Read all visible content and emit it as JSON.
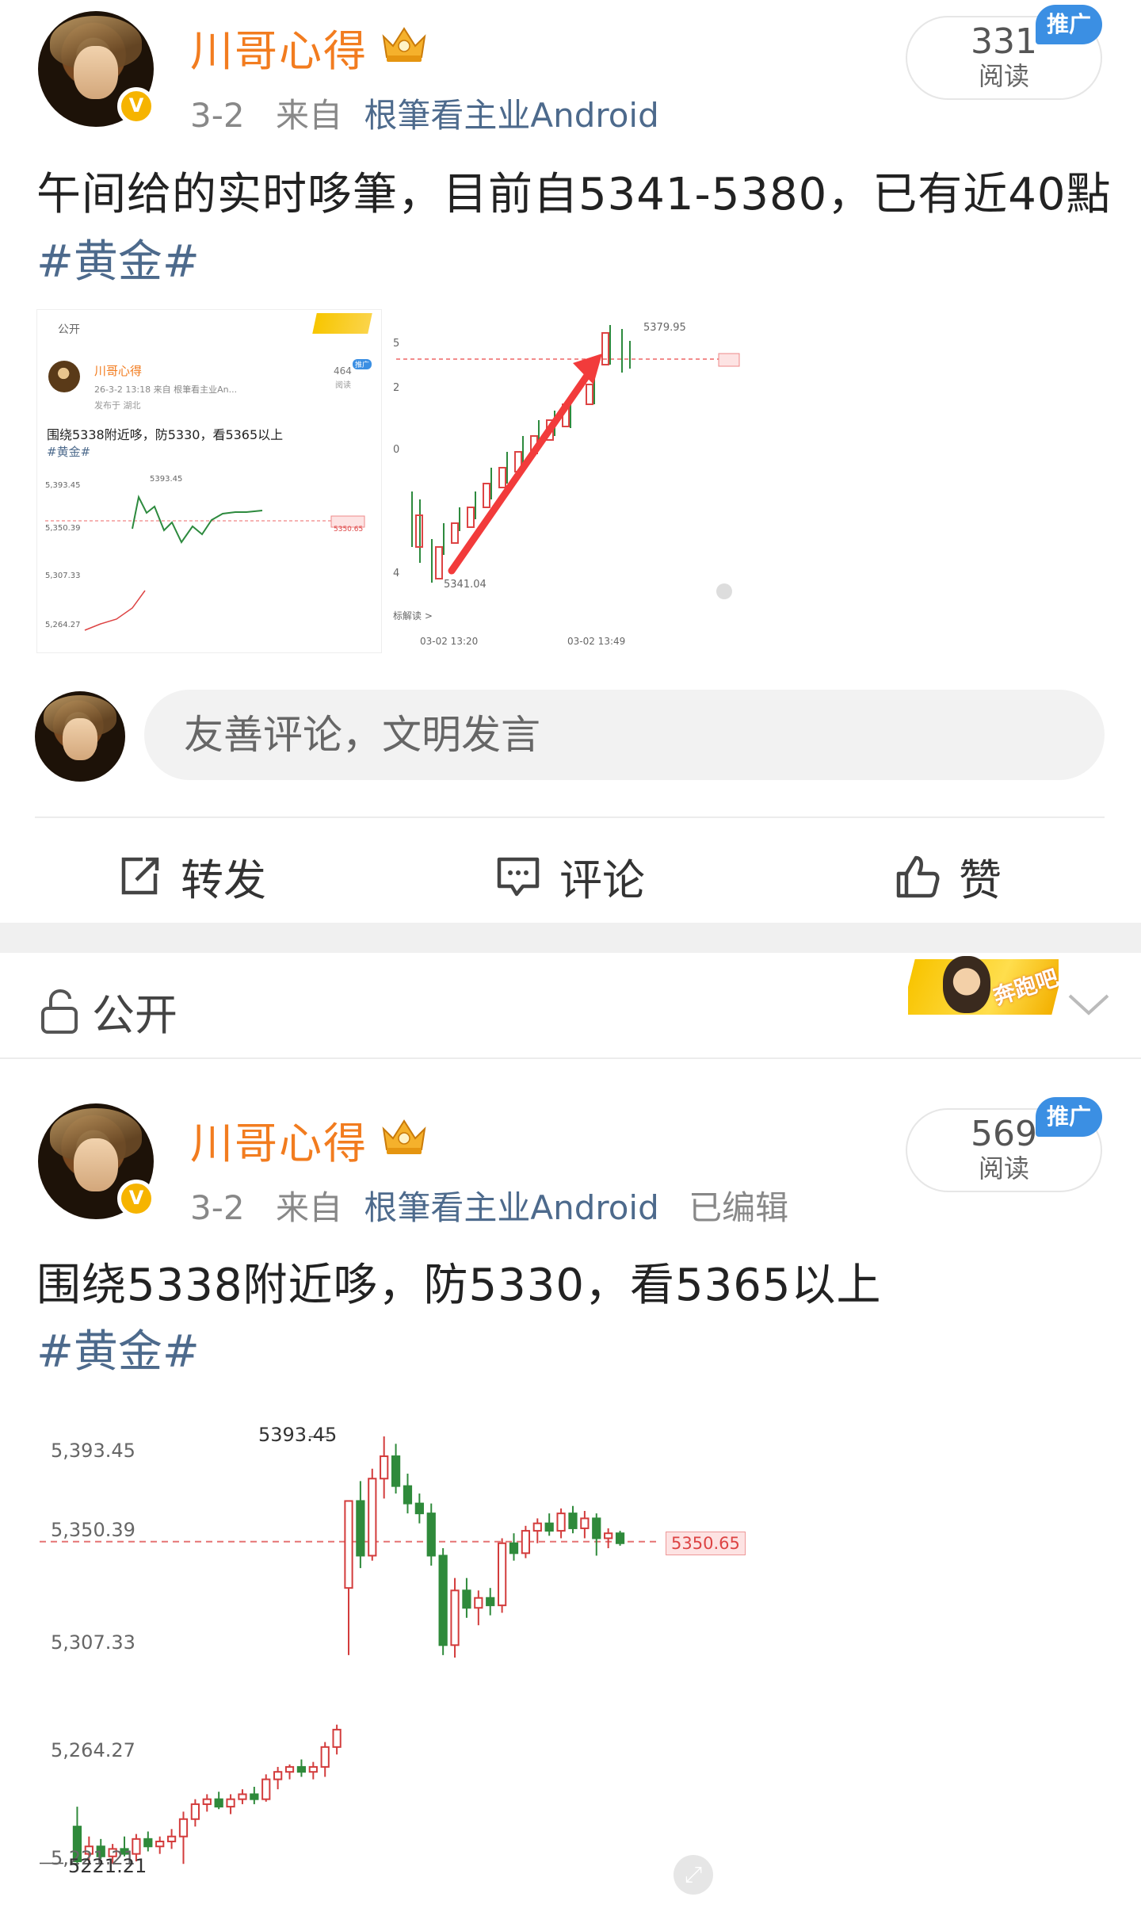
{
  "post1": {
    "author": "川哥心得",
    "date": "3-2",
    "from_prefix": "来自",
    "source": "根筆看主业Android",
    "read_count": "331",
    "read_label": "阅读",
    "promo_label": "推广",
    "text": "午间给的实时哆筆，目前自5341-5380，已有近40點",
    "hashtag": "#黄金#",
    "embedded_card": {
      "visibility": "公开",
      "author": "川哥心得",
      "meta": "26-3-2 13:18  来自 根筆看主业An...",
      "location": "发布于 湖北",
      "text": "围绕5338附近哆，防5330，看5365以上",
      "hashtag": "#黄金#",
      "read_count": "464",
      "read_label": "阅读",
      "promo_label": "推广",
      "chart_labels": [
        "5,393.45",
        "5,350.39",
        "5,307.33",
        "5,264.27"
      ],
      "peak_label": "5393.45",
      "price_tag": "5350.65"
    },
    "right_chart": {
      "peak_label": "5379.95",
      "low_label": "5341.04",
      "y_ticks": [
        "5",
        "2",
        "0",
        "4"
      ],
      "x_labels": [
        "03-02 13:20",
        "03-02 13:49"
      ],
      "link_label": "标解读 >"
    }
  },
  "comment_placeholder": "友善评论，文明发言",
  "actions": {
    "repost": "转发",
    "comment": "评论",
    "like": "赞"
  },
  "visibility_bar": {
    "label": "公开",
    "banner_text": "奔跑吧"
  },
  "post2": {
    "author": "川哥心得",
    "date": "3-2",
    "from_prefix": "来自",
    "source": "根筆看主业Android",
    "edited": "已编辑",
    "read_count": "569",
    "read_label": "阅读",
    "promo_label": "推广",
    "text": "围绕5338附近哆，防5330，看5365以上",
    "hashtag": "#黄金#"
  },
  "chart_data": {
    "type": "candlestick",
    "title": "",
    "y_ticks": [
      "5,393.45",
      "5,350.39",
      "5,307.33",
      "5,264.27",
      "5,221.21"
    ],
    "peak_label": "5393.45",
    "low_label": "5221.21",
    "current_price": "5350.65",
    "ylim": [
      5215,
      5400
    ],
    "candles": [
      {
        "o": 5236,
        "h": 5244,
        "l": 5219,
        "c": 5222
      },
      {
        "o": 5225,
        "h": 5232,
        "l": 5221,
        "c": 5228
      },
      {
        "o": 5228,
        "h": 5231,
        "l": 5223,
        "c": 5224
      },
      {
        "o": 5224,
        "h": 5229,
        "l": 5221,
        "c": 5227
      },
      {
        "o": 5227,
        "h": 5232,
        "l": 5224,
        "c": 5225
      },
      {
        "o": 5225,
        "h": 5233,
        "l": 5222,
        "c": 5231
      },
      {
        "o": 5231,
        "h": 5234,
        "l": 5226,
        "c": 5228
      },
      {
        "o": 5228,
        "h": 5232,
        "l": 5225,
        "c": 5230
      },
      {
        "o": 5230,
        "h": 5235,
        "l": 5227,
        "c": 5232
      },
      {
        "o": 5232,
        "h": 5242,
        "l": 5221,
        "c": 5239
      },
      {
        "o": 5239,
        "h": 5247,
        "l": 5236,
        "c": 5245
      },
      {
        "o": 5245,
        "h": 5249,
        "l": 5242,
        "c": 5247
      },
      {
        "o": 5247,
        "h": 5250,
        "l": 5243,
        "c": 5244
      },
      {
        "o": 5244,
        "h": 5249,
        "l": 5241,
        "c": 5247
      },
      {
        "o": 5247,
        "h": 5251,
        "l": 5245,
        "c": 5249
      },
      {
        "o": 5249,
        "h": 5252,
        "l": 5245,
        "c": 5247
      },
      {
        "o": 5247,
        "h": 5257,
        "l": 5246,
        "c": 5255
      },
      {
        "o": 5255,
        "h": 5260,
        "l": 5251,
        "c": 5258
      },
      {
        "o": 5258,
        "h": 5261,
        "l": 5255,
        "c": 5260
      },
      {
        "o": 5260,
        "h": 5263,
        "l": 5256,
        "c": 5258
      },
      {
        "o": 5258,
        "h": 5262,
        "l": 5255,
        "c": 5260
      },
      {
        "o": 5260,
        "h": 5270,
        "l": 5256,
        "c": 5268
      },
      {
        "o": 5268,
        "h": 5277,
        "l": 5265,
        "c": 5275
      },
      {
        "o": 5332,
        "h": 5351,
        "l": 5305,
        "c": 5367
      },
      {
        "o": 5367,
        "h": 5375,
        "l": 5340,
        "c": 5345
      },
      {
        "o": 5345,
        "h": 5380,
        "l": 5343,
        "c": 5376
      },
      {
        "o": 5376,
        "h": 5393,
        "l": 5368,
        "c": 5385
      },
      {
        "o": 5385,
        "h": 5390,
        "l": 5370,
        "c": 5373
      },
      {
        "o": 5373,
        "h": 5378,
        "l": 5362,
        "c": 5366
      },
      {
        "o": 5366,
        "h": 5370,
        "l": 5358,
        "c": 5362
      },
      {
        "o": 5362,
        "h": 5366,
        "l": 5341,
        "c": 5345
      },
      {
        "o": 5345,
        "h": 5348,
        "l": 5305,
        "c": 5309
      },
      {
        "o": 5309,
        "h": 5336,
        "l": 5304,
        "c": 5331
      },
      {
        "o": 5331,
        "h": 5336,
        "l": 5320,
        "c": 5324
      },
      {
        "o": 5324,
        "h": 5331,
        "l": 5317,
        "c": 5328
      },
      {
        "o": 5328,
        "h": 5332,
        "l": 5321,
        "c": 5325
      },
      {
        "o": 5325,
        "h": 5352,
        "l": 5322,
        "c": 5350
      },
      {
        "o": 5350,
        "h": 5354,
        "l": 5343,
        "c": 5346
      },
      {
        "o": 5346,
        "h": 5357,
        "l": 5344,
        "c": 5355
      },
      {
        "o": 5355,
        "h": 5360,
        "l": 5350,
        "c": 5358
      },
      {
        "o": 5358,
        "h": 5362,
        "l": 5353,
        "c": 5355
      },
      {
        "o": 5355,
        "h": 5364,
        "l": 5352,
        "c": 5362
      },
      {
        "o": 5362,
        "h": 5365,
        "l": 5354,
        "c": 5356
      },
      {
        "o": 5356,
        "h": 5363,
        "l": 5352,
        "c": 5360
      },
      {
        "o": 5360,
        "h": 5362,
        "l": 5345,
        "c": 5352
      },
      {
        "o": 5352,
        "h": 5356,
        "l": 5348,
        "c": 5354
      },
      {
        "o": 5354,
        "h": 5355,
        "l": 5349,
        "c": 5350
      }
    ]
  }
}
